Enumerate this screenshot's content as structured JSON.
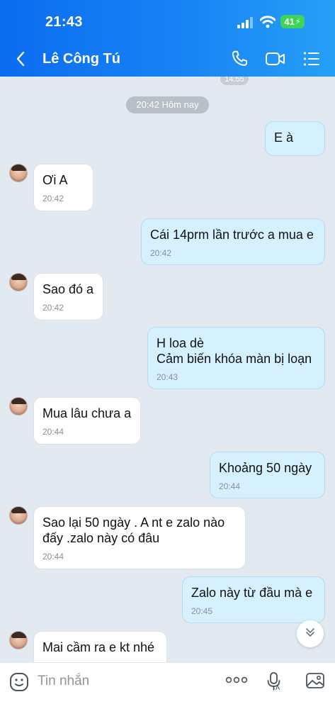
{
  "status_bar": {
    "time": "21:43",
    "battery": "41"
  },
  "header": {
    "contact_name": "Lê Công Tú"
  },
  "chat": {
    "previous_time": "14:55",
    "date_separator": "20:42 Hôm nay",
    "messages": [
      {
        "direction": "out",
        "text": "E à",
        "time": ""
      },
      {
        "direction": "in",
        "text": "Ơi A",
        "time": "20:42"
      },
      {
        "direction": "out",
        "text": "Cái 14prm lần trước a mua e",
        "time": "20:42"
      },
      {
        "direction": "in",
        "text": "Sao đó a",
        "time": "20:42"
      },
      {
        "direction": "out",
        "text": "H loa dè\nCảm biến khóa màn bị loạn",
        "time": "20:43"
      },
      {
        "direction": "in",
        "text": "Mua lâu chưa a",
        "time": "20:44"
      },
      {
        "direction": "out",
        "text": "Khoảng 50 ngày",
        "time": "20:44"
      },
      {
        "direction": "in",
        "text": "Sao lại 50 ngày .  A nt e zalo nào\nđấy .zalo này có đâu",
        "time": "20:44"
      },
      {
        "direction": "out",
        "text": "Zalo này từ đầu mà e",
        "time": "20:45"
      },
      {
        "direction": "in",
        "text": "Mai cầm ra e kt nhé",
        "time": ""
      }
    ]
  },
  "input": {
    "placeholder": "Tin nhắn"
  },
  "icons": {
    "back": "chevron-left-icon",
    "call": "phone-icon",
    "video": "video-camera-icon",
    "menu": "list-menu-icon",
    "emoji": "emoji-icon",
    "more": "more-dots-icon",
    "voice": "microphone-icon",
    "gallery": "image-gallery-icon",
    "scroll": "double-chevron-down-icon"
  },
  "colors": {
    "header_start": "#0a6cf0",
    "header_end": "#25a0f7",
    "chat_background": "#e2e9f1",
    "outgoing_bubble": "#d5f1ff",
    "incoming_bubble": "#ffffff",
    "battery": "#3ed45a"
  }
}
